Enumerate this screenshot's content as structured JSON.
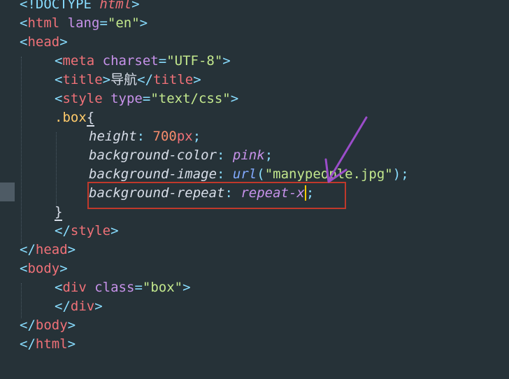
{
  "editor": {
    "lines": {
      "doctype_open": "<!DOCTYPE ",
      "doctype_html": "html",
      "doctype_close": ">",
      "html_tag": "html",
      "lang_attr": "lang",
      "lang_val": "\"en\"",
      "head_tag": "head",
      "meta_tag": "meta",
      "charset_attr": "charset",
      "charset_val": "\"UTF-8\"",
      "title_tag": "title",
      "title_text": "导航",
      "style_tag": "style",
      "type_attr": "type",
      "type_val": "\"text/css\"",
      "selector": ".box",
      "brace_open": "{",
      "brace_close": "}",
      "height_prop": "height",
      "height_num": "700",
      "height_unit": "px",
      "bgcolor_prop": "background-color",
      "bgcolor_val": "pink",
      "bgimage_prop": "background-image",
      "bgimage_func": "url",
      "bgimage_str": "\"manypeople.jpg\"",
      "bgrepeat_prop": "background-repeat",
      "bgrepeat_val_a": "repeat-x",
      "bgrepeat_val_b": ";",
      "body_tag": "body",
      "div_tag": "div",
      "class_attr": "class",
      "class_val": "\"box\""
    }
  },
  "colors": {
    "background": "#263238",
    "highlight_border": "#c0392b",
    "arrow": "#9b4dca",
    "cursor": "#ffcc00"
  }
}
